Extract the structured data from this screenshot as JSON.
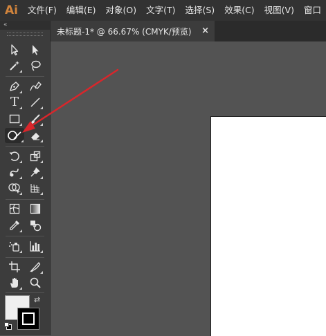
{
  "app": {
    "logo": "Ai"
  },
  "menu": {
    "items": [
      {
        "label": "文件(F)"
      },
      {
        "label": "编辑(E)"
      },
      {
        "label": "对象(O)"
      },
      {
        "label": "文字(T)"
      },
      {
        "label": "选择(S)"
      },
      {
        "label": "效果(C)"
      },
      {
        "label": "视图(V)"
      },
      {
        "label": "窗口"
      }
    ]
  },
  "toolbar": {
    "collapse_icon": "«",
    "tools": [
      {
        "name": "selection-tool",
        "icon": "selection-arrow-icon"
      },
      {
        "name": "direct-selection-tool",
        "icon": "direct-selection-arrow-icon"
      },
      {
        "name": "magic-wand-tool",
        "icon": "magic-wand-icon"
      },
      {
        "name": "lasso-tool",
        "icon": "lasso-icon"
      },
      {
        "name": "pen-tool",
        "icon": "pen-icon"
      },
      {
        "name": "curvature-tool",
        "icon": "curvature-pen-icon"
      },
      {
        "name": "type-tool",
        "icon": "type-icon",
        "glyph": "T"
      },
      {
        "name": "line-segment-tool",
        "icon": "line-icon"
      },
      {
        "name": "rectangle-tool",
        "icon": "rectangle-icon"
      },
      {
        "name": "paintbrush-tool",
        "icon": "paintbrush-icon"
      },
      {
        "name": "shaper-tool",
        "icon": "shaper-icon",
        "active": true
      },
      {
        "name": "eraser-tool",
        "icon": "eraser-icon"
      },
      {
        "name": "rotate-tool",
        "icon": "rotate-icon"
      },
      {
        "name": "scale-tool",
        "icon": "scale-icon"
      },
      {
        "name": "warp-tool",
        "icon": "warp-icon"
      },
      {
        "name": "puppet-warp-tool",
        "icon": "pushpin-icon"
      },
      {
        "name": "shape-builder-tool",
        "icon": "shape-builder-icon"
      },
      {
        "name": "perspective-grid-tool",
        "icon": "perspective-grid-icon"
      },
      {
        "name": "mesh-tool",
        "icon": "mesh-icon"
      },
      {
        "name": "gradient-tool",
        "icon": "gradient-icon"
      },
      {
        "name": "eyedropper-tool",
        "icon": "eyedropper-icon"
      },
      {
        "name": "blend-tool",
        "icon": "blend-icon"
      },
      {
        "name": "symbol-sprayer-tool",
        "icon": "symbol-sprayer-icon"
      },
      {
        "name": "column-graph-tool",
        "icon": "bar-graph-icon"
      },
      {
        "name": "artboard-tool",
        "icon": "artboard-icon"
      },
      {
        "name": "slice-tool",
        "icon": "slice-knife-icon"
      },
      {
        "name": "hand-tool",
        "icon": "hand-icon"
      },
      {
        "name": "zoom-tool",
        "icon": "magnifier-icon"
      }
    ],
    "swap_icon": "⇄",
    "fill_color": "#efefef",
    "stroke_color": "#000000"
  },
  "document": {
    "tab_title": "未标题-1* @ 66.67% (CMYK/预览)",
    "close_glyph": "×"
  },
  "colors": {
    "accent_logo": "#ff9a00",
    "annotation_arrow": "#d9262b",
    "canvas_bg": "#535353",
    "artboard": "#ffffff"
  }
}
